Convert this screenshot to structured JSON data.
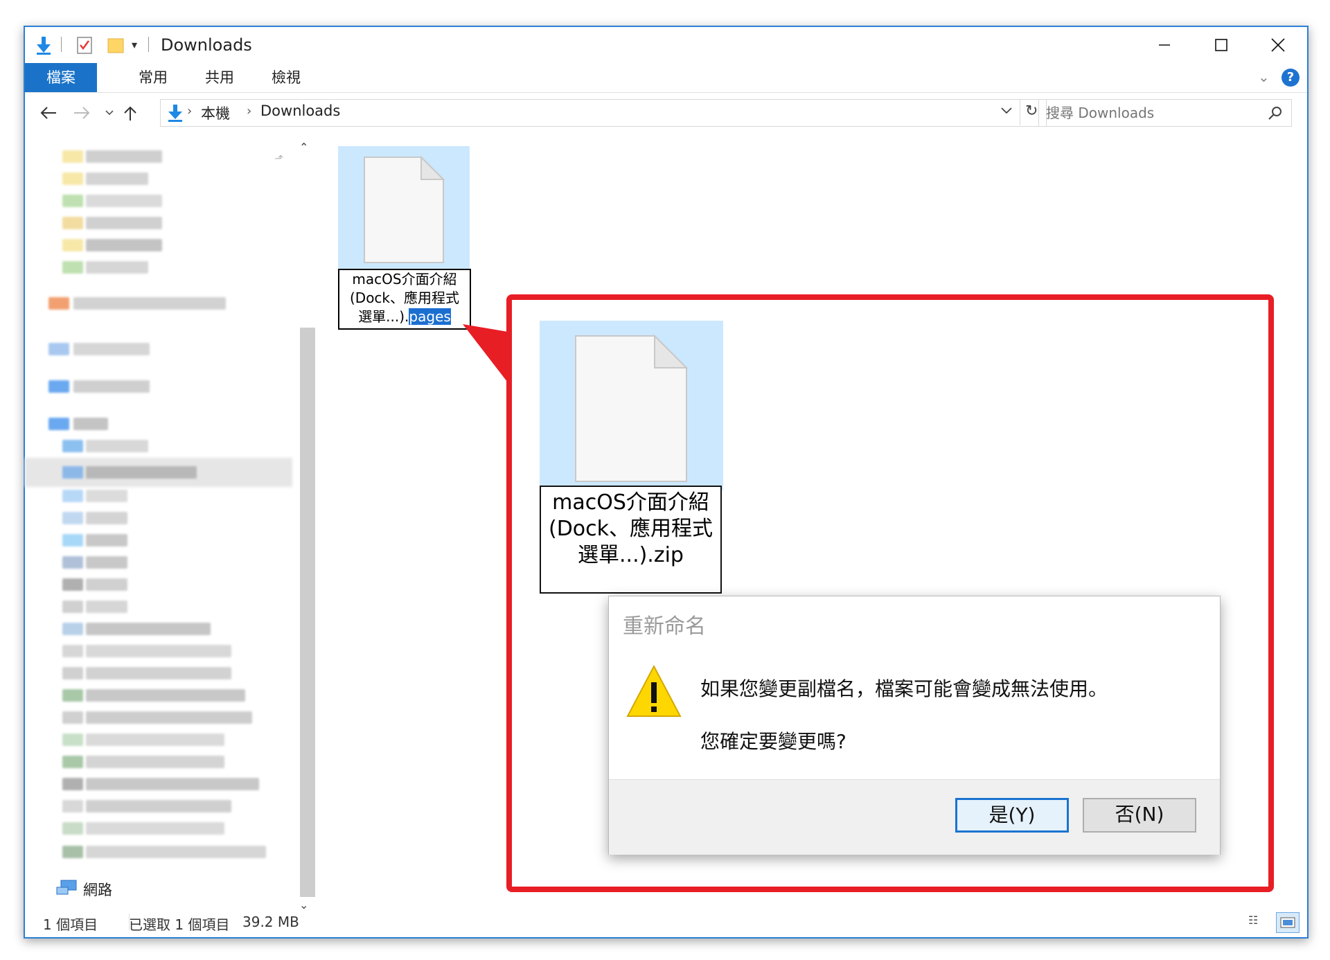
{
  "window": {
    "title": "Downloads",
    "controls": {
      "minimize": "—",
      "maximize": "☐",
      "close": "✕"
    }
  },
  "ribbon": {
    "tabs": [
      "檔案",
      "常用",
      "共用",
      "檢視"
    ],
    "help": "?"
  },
  "address": {
    "path": [
      "本機",
      "Downloads"
    ],
    "search_placeholder": "搜尋 Downloads"
  },
  "sidebar": {
    "network_label": "網路"
  },
  "file": {
    "name_line1": "macOS介面介紹",
    "name_line2": "(Dock、應用程式",
    "name_line3_prefix": "選單...).",
    "name_selected_ext": "pages"
  },
  "status": {
    "count": "1 個項目",
    "selected": "已選取 1 個項目",
    "size": "39.2 MB"
  },
  "zoom": {
    "line1": "macOS介面介紹",
    "line2": "(Dock、應用程式",
    "line3": "選單...).zip"
  },
  "dialog": {
    "title": "重新命名",
    "message1": "如果您變更副檔名，檔案可能會變成無法使用。",
    "message2": "您確定要變更嗎?",
    "yes": "是(Y)",
    "no": "否(N)"
  },
  "colors": {
    "accent": "#1a73c9",
    "selection": "#cce8ff",
    "callout": "#e81e25",
    "warning": "#ffd700"
  }
}
